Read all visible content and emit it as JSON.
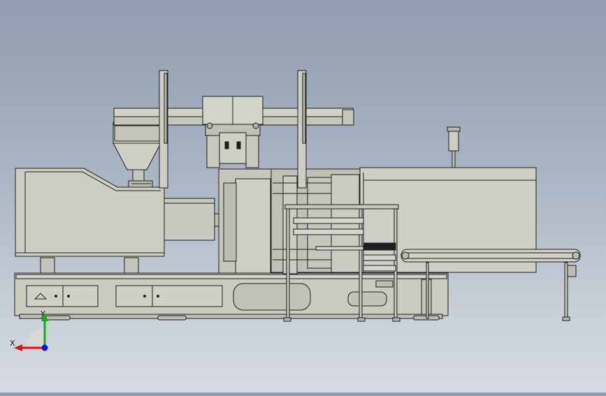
{
  "viewport": {
    "view": "front",
    "background_top": "#8f9db0",
    "background_bottom": "#d6dbe1",
    "model_fill": "#c8c8bf",
    "model_edge": "#1e1e1e"
  },
  "triad": {
    "x_label": "X",
    "y_label": "Y",
    "x_color": "#e01010",
    "y_color": "#10b010",
    "z_color": "#1010e0"
  }
}
